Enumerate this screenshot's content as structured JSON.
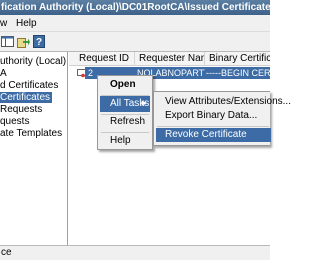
{
  "window": {
    "title": "fication Authority (Local)\\DC01RootCA\\Issued Certificates]"
  },
  "menu": {
    "items": [
      "w",
      "Help"
    ]
  },
  "toolbar": {
    "icons": [
      "pane-icon",
      "export-icon",
      "help-icon"
    ]
  },
  "tree": {
    "items": [
      {
        "label": "uthority (Local)",
        "selected": false
      },
      {
        "label": "A",
        "selected": false
      },
      {
        "label": "d Certificates",
        "selected": false
      },
      {
        "label": "Certificates",
        "selected": true
      },
      {
        "label": "Requests",
        "selected": false
      },
      {
        "label": "quests",
        "selected": false
      },
      {
        "label": "ate Templates",
        "selected": false
      }
    ]
  },
  "list": {
    "columns": [
      "Request ID",
      "Requester Name",
      "Binary Certificate"
    ],
    "rows": [
      {
        "request_id": "2",
        "requester": "NOLABNOPARTY...",
        "binary": "-----BEGIN CERTI..."
      }
    ]
  },
  "context_menu": {
    "items": [
      {
        "label": "Open",
        "bold": true,
        "highlighted": false,
        "submenu": false
      },
      {
        "label": "All Tasks",
        "bold": false,
        "highlighted": true,
        "submenu": true
      },
      {
        "label": "Refresh",
        "bold": false,
        "highlighted": false,
        "submenu": false
      },
      {
        "label": "Help",
        "bold": false,
        "highlighted": false,
        "submenu": false
      }
    ]
  },
  "submenu": {
    "items": [
      {
        "label": "View Attributes/Extensions...",
        "highlighted": false
      },
      {
        "label": "Export Binary Data...",
        "highlighted": false
      },
      {
        "label": "Revoke Certificate",
        "highlighted": true
      }
    ]
  },
  "status": {
    "text": "ce"
  },
  "colors": {
    "highlight": "#3c6ba5",
    "titlebar": "#4a6f97"
  }
}
